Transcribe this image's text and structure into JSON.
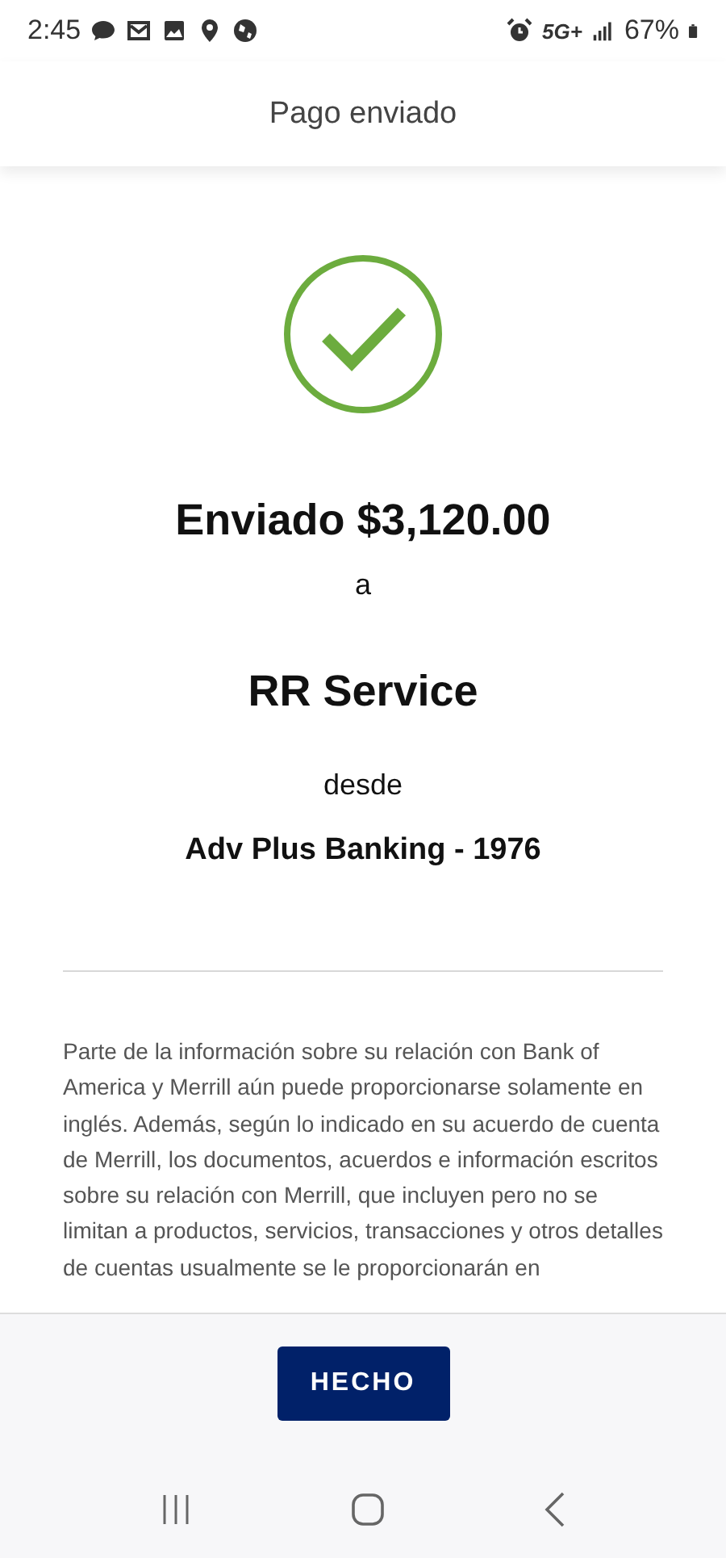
{
  "status_bar": {
    "time": "2:45",
    "network": "5G+",
    "battery": "67%"
  },
  "header": {
    "title": "Pago enviado"
  },
  "confirmation": {
    "amount_line": "Enviado $3,120.00",
    "to_word": "a",
    "payee": "RR Service",
    "from_word": "desde",
    "account": "Adv Plus Banking - 1976"
  },
  "disclaimer": "Parte de la información sobre su relación con Bank of America y Merrill aún puede proporcionarse solamente en inglés. Además, según lo indicado en su acuerdo de cuenta de Merrill, los documentos, acuerdos e información escritos sobre su relación con Merrill, que incluyen pero no se limitan a productos, servicios, transacciones y otros detalles de cuentas usualmente se le proporcionarán en",
  "footer": {
    "button": "HECHO"
  }
}
